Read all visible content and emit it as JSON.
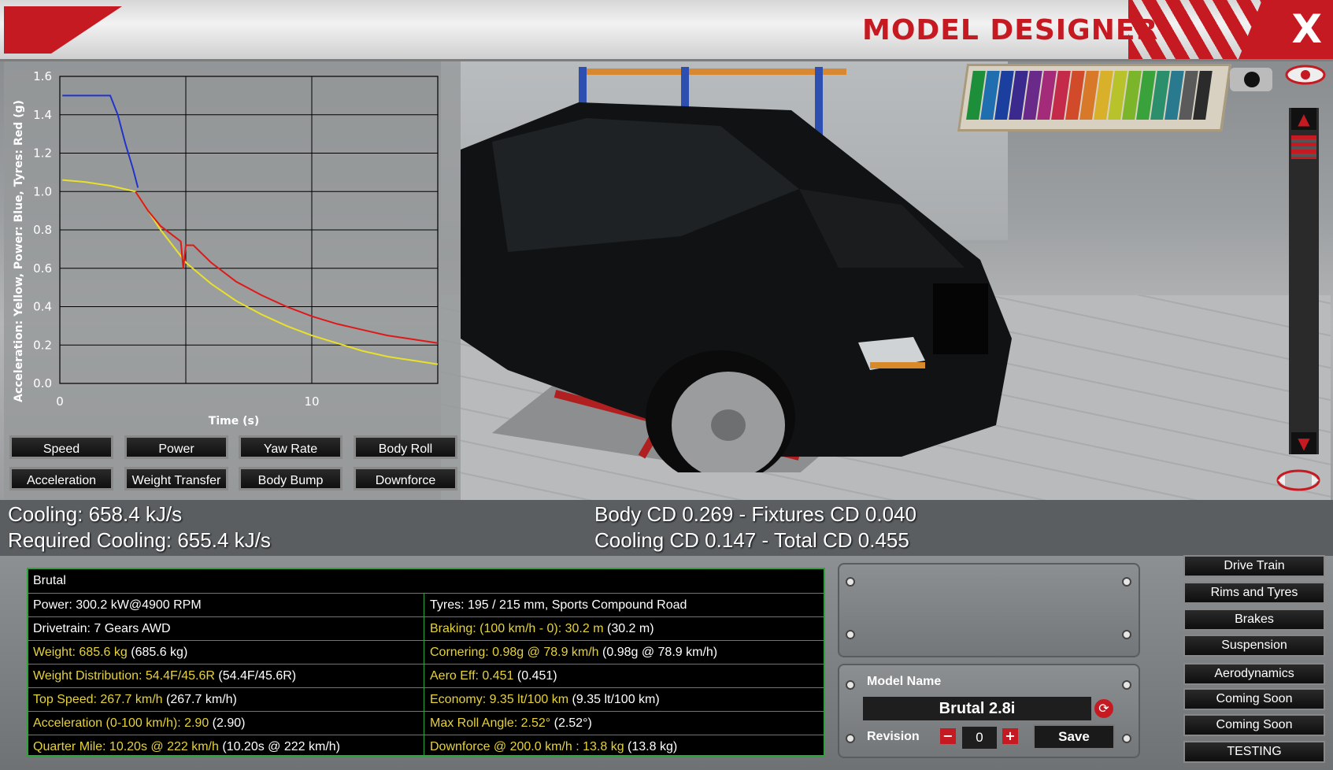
{
  "title": "MODEL DESIGNER",
  "close_label": "X",
  "chart_data": {
    "type": "line",
    "xlabel": "Time (s)",
    "ylabel": "Acceleration: Yellow, Power: Blue, Tyres: Red (g)",
    "xlim": [
      0,
      15
    ],
    "ylim": [
      0.0,
      1.6
    ],
    "xticks": [
      "0",
      "10"
    ],
    "yticks": [
      "0.0",
      "0.2",
      "0.4",
      "0.6",
      "0.8",
      "1.0",
      "1.2",
      "1.4",
      "1.6"
    ],
    "grid": true,
    "series": [
      {
        "color": "#2233cc",
        "points": [
          [
            0.1,
            1.5
          ],
          [
            2.0,
            1.5
          ],
          [
            2.3,
            1.4
          ],
          [
            2.6,
            1.25
          ],
          [
            2.9,
            1.12
          ],
          [
            3.1,
            1.02
          ]
        ]
      },
      {
        "color": "#e8e02a",
        "points": [
          [
            0.1,
            1.06
          ],
          [
            1.0,
            1.05
          ],
          [
            2.0,
            1.03
          ],
          [
            3.0,
            1.0
          ],
          [
            4.0,
            0.8
          ],
          [
            5.0,
            0.63
          ],
          [
            6.0,
            0.52
          ],
          [
            7.0,
            0.43
          ],
          [
            8.0,
            0.36
          ],
          [
            9.0,
            0.3
          ],
          [
            10.0,
            0.25
          ],
          [
            11.0,
            0.21
          ],
          [
            12.0,
            0.17
          ],
          [
            13.0,
            0.14
          ],
          [
            14.0,
            0.12
          ],
          [
            15.0,
            0.1
          ]
        ]
      },
      {
        "color": "#e01818",
        "points": [
          [
            3.0,
            1.0
          ],
          [
            3.5,
            0.9
          ],
          [
            4.0,
            0.82
          ],
          [
            4.5,
            0.77
          ],
          [
            4.8,
            0.74
          ],
          [
            4.9,
            0.6
          ],
          [
            5.0,
            0.72
          ],
          [
            5.3,
            0.72
          ],
          [
            6.0,
            0.63
          ],
          [
            7.0,
            0.53
          ],
          [
            8.0,
            0.46
          ],
          [
            9.0,
            0.4
          ],
          [
            10.0,
            0.35
          ],
          [
            11.0,
            0.31
          ],
          [
            12.0,
            0.28
          ],
          [
            13.0,
            0.25
          ],
          [
            14.0,
            0.23
          ],
          [
            15.0,
            0.21
          ]
        ]
      }
    ]
  },
  "chart_buttons": [
    "Speed",
    "Power",
    "Yaw Rate",
    "Body Roll",
    "Acceleration",
    "Weight Transfer",
    "Body Bump",
    "Downforce"
  ],
  "stats": {
    "cooling": "Cooling: 658.4 kJ/s",
    "required_cooling": "Required Cooling: 655.4 kJ/s",
    "body_cd": "Body CD 0.269 - Fixtures CD 0.040",
    "cooling_cd": "Cooling CD 0.147 - Total CD 0.455"
  },
  "info": {
    "name": "Brutal",
    "left": [
      {
        "label": "Power: 300.2 kW@4900 RPM",
        "extra": ""
      },
      {
        "label": "Drivetrain: 7 Gears AWD",
        "extra": ""
      },
      {
        "label": "Weight: 685.6 kg",
        "extra": "(685.6 kg)"
      },
      {
        "label": "Weight Distribution: 54.4F/45.6R",
        "extra": "(54.4F/45.6R)"
      },
      {
        "label": "Top Speed: 267.7 km/h",
        "extra": "(267.7 km/h)"
      },
      {
        "label": "Acceleration (0-100 km/h): 2.90",
        "extra": "(2.90)"
      },
      {
        "label": "Quarter Mile: 10.20s @ 222 km/h",
        "extra": "(10.20s @ 222 km/h)"
      }
    ],
    "right": [
      {
        "label": "Tyres: 195 / 215 mm, Sports Compound Road",
        "extra": ""
      },
      {
        "label": "Braking: (100 km/h - 0): 30.2 m",
        "extra": "(30.2 m)"
      },
      {
        "label": "Cornering: 0.98g @ 78.9 km/h",
        "extra": "(0.98g @ 78.9 km/h)"
      },
      {
        "label": "Aero Eff: 0.451",
        "extra": "(0.451)"
      },
      {
        "label": "Economy: 9.35 lt/100 km",
        "extra": "(9.35 lt/100 km)"
      },
      {
        "label": "Max Roll Angle: 2.52°",
        "extra": "(2.52°)"
      },
      {
        "label": "Downforce @ 200.0 km/h : 13.8 kg",
        "extra": "(13.8 kg)"
      }
    ]
  },
  "model": {
    "name_label": "Model Name",
    "name_value": "Brutal 2.8i",
    "revision_label": "Revision",
    "revision_value": "0",
    "minus": "−",
    "plus": "+",
    "save": "Save"
  },
  "nav": [
    "Drive Train",
    "Rims and Tyres",
    "Brakes",
    "Suspension",
    "Aerodynamics",
    "Coming Soon",
    "Coming Soon",
    "TESTING"
  ],
  "colors": {
    "accent_red": "#c61a22",
    "table_green": "#2ea33a",
    "stat_yellow": "#e6d23a"
  }
}
